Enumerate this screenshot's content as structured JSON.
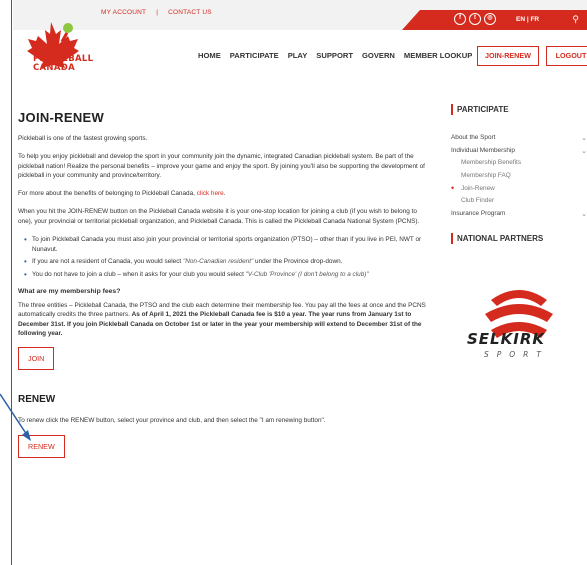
{
  "topbar": {
    "my_account": "MY ACCOUNT",
    "separator": "|",
    "contact_us": "CONTACT US",
    "lang": "EN | FR"
  },
  "brand": {
    "line1": "PICKLEBALL",
    "line2": "CANADA"
  },
  "nav": {
    "home": "HOME",
    "participate": "PARTICIPATE",
    "play": "PLAY",
    "support": "SUPPORT",
    "govern": "GOVERN",
    "member_lookup": "MEMBER LOOKUP",
    "join_renew": "JOIN-RENEW",
    "logout": "LOGOUT"
  },
  "main": {
    "title": "JOIN-RENEW",
    "p1": "Pickleball is one of the fastest growing sports.",
    "p2": "To help you enjoy pickleball and develop the sport in your community join the dynamic, integrated Canadian pickleball system. Be part of the pickleball nation! Realize the personal benefits – improve your game and enjoy the sport. By joining you'll also be supporting the development of pickleball in your community and province/territory.",
    "p3_prefix": "For more about the benefits of belonging to Pickleball Canada, ",
    "p3_link": "click here",
    "p3_suffix": ".",
    "p4": "When you hit the JOIN-RENEW button on the Pickleball Canada website it is your one-stop location for joining a club (if you wish to belong to one), your provincial or territorial pickleball organization, and Pickleball Canada. This is called the Pickleball Canada National System (PCNS).",
    "bullet1": "To join Pickleball Canada you must also join your provincial or territorial sports organization (PTSO) – other than if you live in PEI, NWT or Nunavut.",
    "bullet2_prefix": "If you are not a resident of Canada, you would select ",
    "bullet2_em": "\"Non-Canadian resident\"",
    "bullet2_suffix": " under the Province drop-down.",
    "bullet3_prefix": "You do not have to join a club – when it asks for your club you would select ",
    "bullet3_em": "\"V-Club 'Province' (I don't belong to a club)\"",
    "fees_heading": "What are my membership fees?",
    "fees_p1": "The three entities – Pickleball Canada, the PTSO and the club each determine their membership fee. You pay all the fees at once and the PCNS automatically credits the three partners. ",
    "fees_p2": "As of April 1, 2021 the Pickleball Canada fee is $10 a year. The year runs from January 1st to December 31st. If you join Pickleball Canada on October 1st or later in the year your membership will extend to December 31st of the following year.",
    "join_button": "JOIN",
    "renew_heading": "RENEW",
    "renew_text": "To renew click the RENEW button, select your province and club, and then select the \"I am renewing button\".",
    "renew_button": "RENEW"
  },
  "sidebar": {
    "heading": "PARTICIPATE",
    "items": [
      {
        "label": "About the Sport"
      },
      {
        "label": "Individual Membership"
      },
      {
        "label": "Membership Benefits"
      },
      {
        "label": "Membership FAQ"
      },
      {
        "label": "Join-Renew"
      },
      {
        "label": "Club Finder"
      },
      {
        "label": "Insurance Program"
      }
    ],
    "partners_heading": "NATIONAL PARTNERS",
    "partner_name": "SELKIRK",
    "partner_sub": "SPORT"
  },
  "colors": {
    "brand_red": "#d52b1e",
    "frame_blue": "#2c5fa8"
  }
}
